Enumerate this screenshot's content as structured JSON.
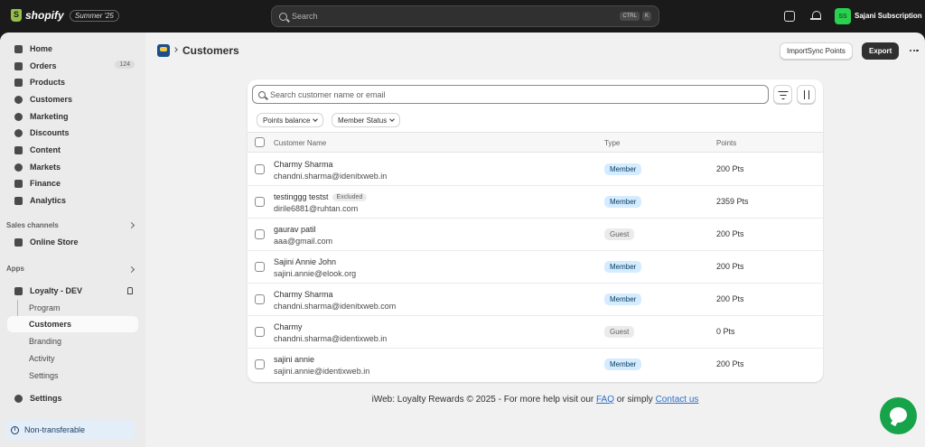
{
  "topbar": {
    "brand": "shopify",
    "badge": "Summer '25",
    "search_placeholder": "Search",
    "kbd_ctrl": "CTRL",
    "kbd_k": "K",
    "avatar_initials": "SS",
    "store_name": "Sajani Subscription"
  },
  "sidebar": {
    "items": [
      {
        "label": "Home",
        "icon": "home-icon"
      },
      {
        "label": "Orders",
        "icon": "orders-icon",
        "count": "124"
      },
      {
        "label": "Products",
        "icon": "products-icon"
      },
      {
        "label": "Customers",
        "icon": "customers-icon"
      },
      {
        "label": "Marketing",
        "icon": "marketing-icon"
      },
      {
        "label": "Discounts",
        "icon": "discounts-icon"
      },
      {
        "label": "Content",
        "icon": "content-icon"
      },
      {
        "label": "Markets",
        "icon": "markets-icon"
      },
      {
        "label": "Finance",
        "icon": "finance-icon"
      },
      {
        "label": "Analytics",
        "icon": "analytics-icon"
      }
    ],
    "sales_channels_label": "Sales channels",
    "online_store": "Online Store",
    "apps_label": "Apps",
    "app_name": "Loyalty - DEV",
    "app_subitems": [
      "Program",
      "Customers",
      "Branding",
      "Activity",
      "Settings"
    ],
    "settings": "Settings",
    "non_transferable": "Non-transferable"
  },
  "header": {
    "title": "Customers",
    "import_button": "ImportSync Points",
    "export_button": "Export"
  },
  "table": {
    "search_placeholder": "Search customer name or email",
    "filters": [
      "Points balance",
      "Member Status"
    ],
    "columns": [
      "Customer Name",
      "Type",
      "Points"
    ],
    "rows": [
      {
        "name": "Charmy Sharma",
        "email": "chandni.sharma@idenitxweb.in",
        "tag": "",
        "type": "Member",
        "points": "200 Pts"
      },
      {
        "name": "testinggg testst",
        "email": "dirile6881@ruhtan.com",
        "tag": "Excluded",
        "type": "Member",
        "points": "2359 Pts"
      },
      {
        "name": "gaurav patil",
        "email": "aaa@gmail.com",
        "tag": "",
        "type": "Guest",
        "points": "200 Pts"
      },
      {
        "name": "Sajini Annie John",
        "email": "sajini.annie@elook.org",
        "tag": "",
        "type": "Member",
        "points": "200 Pts"
      },
      {
        "name": "Charmy Sharma",
        "email": "chandni.sharma@idenitxweb.com",
        "tag": "",
        "type": "Member",
        "points": "200 Pts"
      },
      {
        "name": "Charmy",
        "email": "chandni.sharma@identixweb.in",
        "tag": "",
        "type": "Guest",
        "points": "0 Pts"
      },
      {
        "name": "sajini annie",
        "email": "sajini.annie@identixweb.in",
        "tag": "",
        "type": "Member",
        "points": "200 Pts"
      }
    ]
  },
  "footer": {
    "text_before": "iWeb: Loyalty Rewards © 2025 - For more help visit our ",
    "faq": "FAQ",
    "text_middle": " or simply ",
    "contact": "Contact us"
  }
}
